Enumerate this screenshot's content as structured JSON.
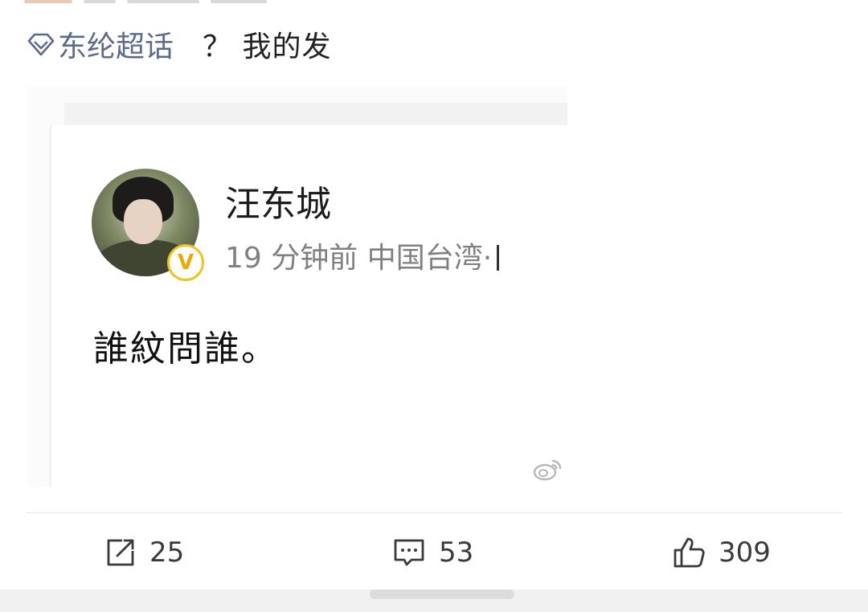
{
  "post": {
    "topic_label": "东纶超话",
    "text": "？ 我的发"
  },
  "embed": {
    "author_name": "汪东城",
    "meta_text": "19 分钟前 中国台湾·",
    "verified_badge": "V",
    "body_text": "誰紋問誰。"
  },
  "actions": {
    "share_count": "25",
    "comment_count": "53",
    "like_count": "309"
  },
  "icons": {
    "topic": "diamond-icon",
    "share": "share-icon",
    "comment": "comment-icon",
    "like": "thumbs-up-icon",
    "watermark": "weibo-icon"
  },
  "colors": {
    "topic_link": "#5b6b8c",
    "verified": "#f0c419",
    "meta_text": "#808080"
  }
}
